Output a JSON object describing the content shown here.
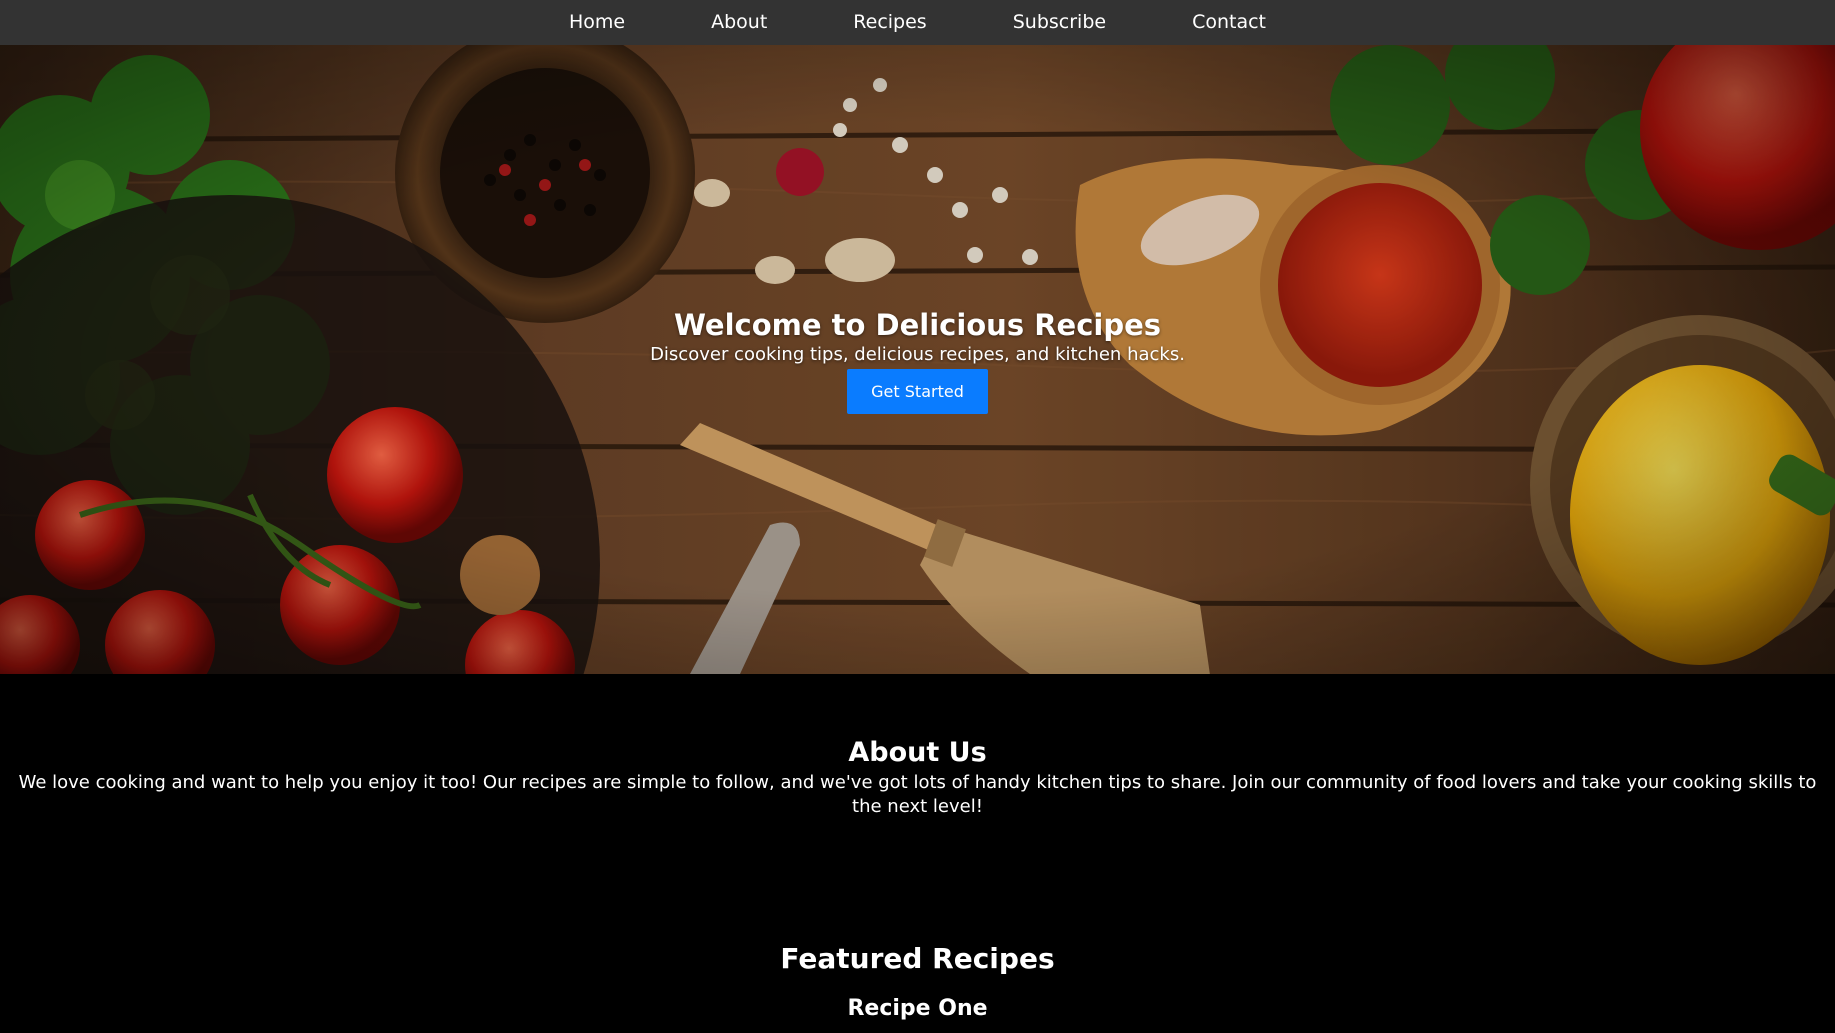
{
  "nav": {
    "items": [
      {
        "label": "Home"
      },
      {
        "label": "About"
      },
      {
        "label": "Recipes"
      },
      {
        "label": "Subscribe"
      },
      {
        "label": "Contact"
      }
    ]
  },
  "hero": {
    "title": "Welcome to Delicious Recipes",
    "subtitle": "Discover cooking tips, delicious recipes, and kitchen hacks.",
    "button_label": "Get Started"
  },
  "about": {
    "title": "About Us",
    "text": "We love cooking and want to help you enjoy it too! Our recipes are simple to follow, and we've got lots of handy kitchen tips to share. Join our community of food lovers and take your cooking skills to the next level!"
  },
  "featured": {
    "title": "Featured Recipes",
    "recipes": [
      {
        "title": "Recipe One"
      }
    ]
  },
  "colors": {
    "nav_bg": "#333333",
    "page_bg": "#000000",
    "button_bg": "#0a7cff",
    "text": "#ffffff"
  }
}
